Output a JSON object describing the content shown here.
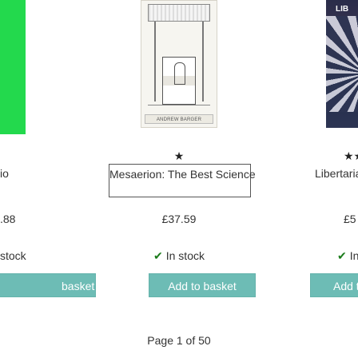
{
  "products": [
    {
      "title_text": "io",
      "price": ".88",
      "stock": "stock",
      "button": "basket",
      "rating": ""
    },
    {
      "title_text": "Mesaerion: The Best Science",
      "price": "£37.59",
      "stock": "In stock",
      "button": "Add to basket",
      "rating": "★",
      "cover_author": "ANDREW BARGER"
    },
    {
      "title_text": "Libertarianism",
      "price": "£5",
      "stock": "In",
      "button": "Add to",
      "rating": "★★",
      "cover_label": "LIB"
    }
  ],
  "pager": "Page 1 of 50",
  "colors": {
    "button": "#6dbcb5",
    "check": "#1a7b1a",
    "green_cover": "#23d94d"
  },
  "icons": {
    "check": "check-icon",
    "star": "star-icon"
  }
}
